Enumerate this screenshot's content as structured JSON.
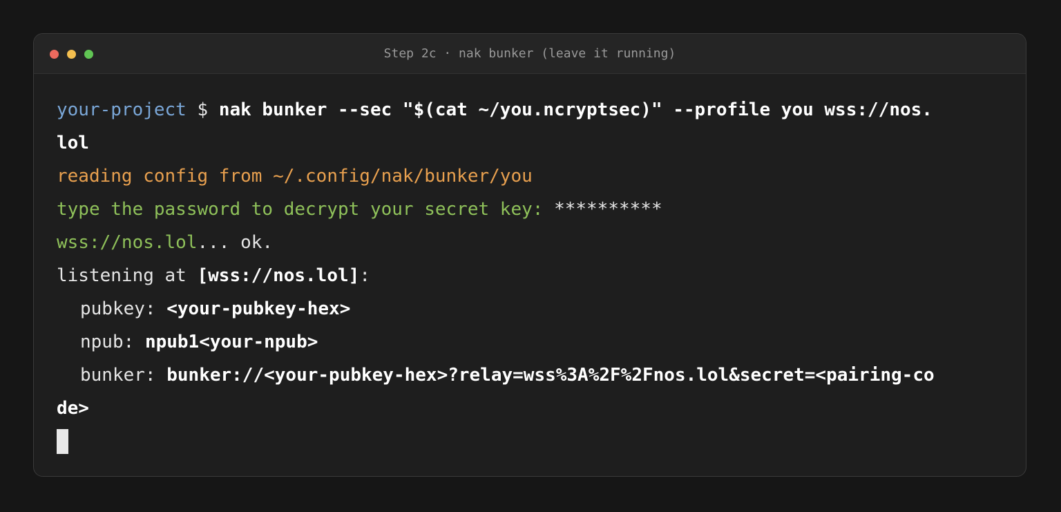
{
  "window": {
    "title": "Step 2c · nak bunker (leave it running)",
    "traffic_lights": {
      "close": "#ed6a5e",
      "minimize": "#f4bf4f",
      "zoom": "#61c554"
    }
  },
  "colors": {
    "prompt_path": "#7aa7d8",
    "info_orange": "#e8a04f",
    "info_green": "#8fc15a",
    "text": "#e6e6e6",
    "background": "#1e1e1e"
  },
  "terminal": {
    "prompt_path": "your-project",
    "prompt_symbol": "$",
    "command_1": "nak bunker --sec \"$(cat ~/you.ncryptsec)\" --profile you wss://nos.",
    "command_2": "lol",
    "config_line": "reading config from ~/.config/nak/bunker/you",
    "password_prompt": "type the password to decrypt your secret key:",
    "password_mask": "**********",
    "relay_url": "wss://nos.lol",
    "relay_status": "... ok.",
    "listening_label": "listening at",
    "listening_relays": "[wss://nos.lol]",
    "listening_colon": ":",
    "pubkey_label": "pubkey:",
    "pubkey_value": "<your-pubkey-hex>",
    "npub_label": "npub:",
    "npub_value": "npub1<your-npub>",
    "bunker_label": "bunker:",
    "bunker_value_1": "bunker://<your-pubkey-hex>?relay=wss%3A%2F%2Fnos.lol&secret=<pairing-co",
    "bunker_value_2": "de>"
  }
}
